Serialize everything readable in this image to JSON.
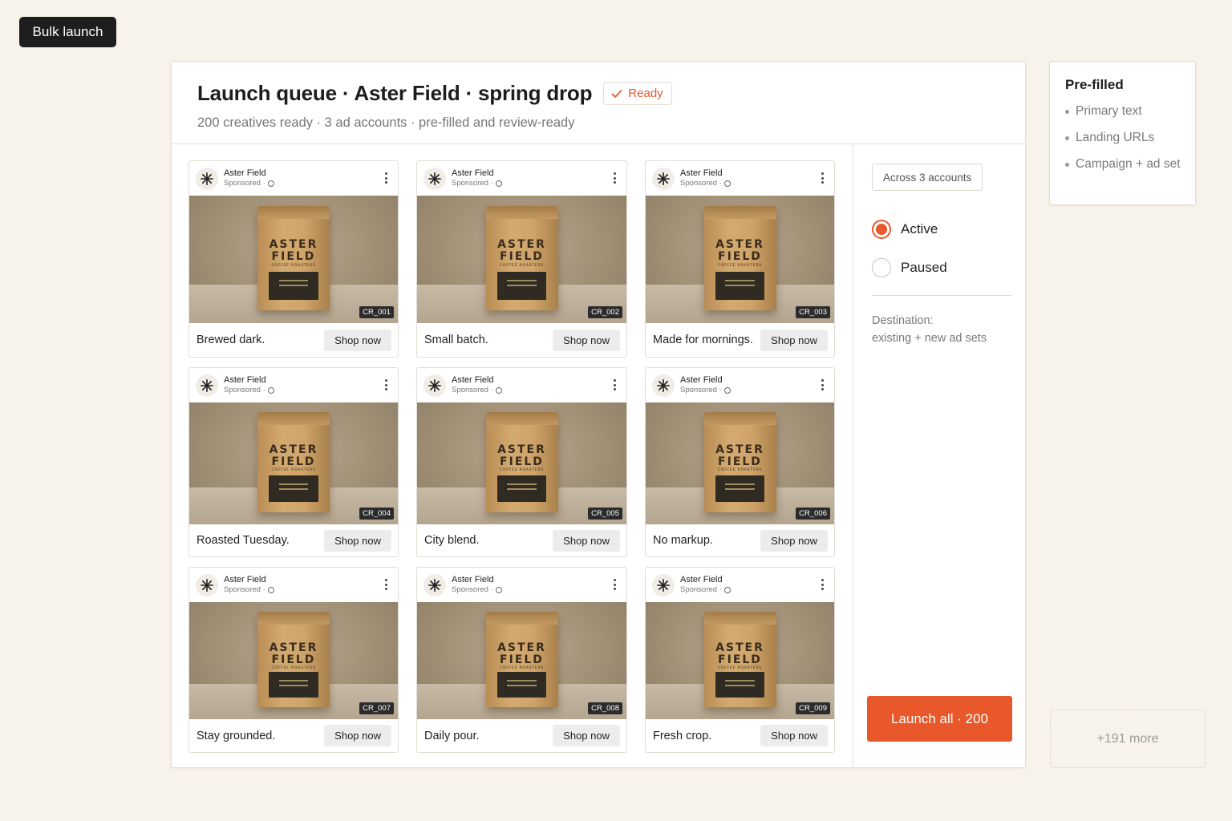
{
  "top_button": {
    "label": "Bulk launch"
  },
  "queue": {
    "title": "Launch queue · Aster Field · spring drop",
    "status": "Ready",
    "subtitle": "200 creatives ready · 3 ad accounts · pre-filled and review-ready"
  },
  "brand": {
    "name": "Aster Field",
    "sponsored": "Sponsored ·"
  },
  "bag": {
    "line1": "ASTER",
    "line2": "FIELD",
    "line3": "COFFEE ROASTERS"
  },
  "cta": "Shop now",
  "creatives": [
    {
      "id": "CR_001",
      "headline": "Brewed dark."
    },
    {
      "id": "CR_002",
      "headline": "Small batch."
    },
    {
      "id": "CR_003",
      "headline": "Made for mornings."
    },
    {
      "id": "CR_004",
      "headline": "Roasted Tuesday."
    },
    {
      "id": "CR_005",
      "headline": "City blend."
    },
    {
      "id": "CR_006",
      "headline": "No markup."
    },
    {
      "id": "CR_007",
      "headline": "Stay grounded."
    },
    {
      "id": "CR_008",
      "headline": "Daily pour."
    },
    {
      "id": "CR_009",
      "headline": "Fresh crop."
    }
  ],
  "settings": {
    "accounts_chip": "Across 3 accounts",
    "status_options": [
      {
        "label": "Active",
        "selected": true
      },
      {
        "label": "Paused",
        "selected": false
      }
    ],
    "destination_label": "Destination:",
    "destination_value": "existing + new ad sets",
    "launch_label": "Launch all · 200"
  },
  "prefilled": {
    "title": "Pre-filled",
    "items": [
      "Primary text",
      "Landing URLs",
      "Campaign + ad set"
    ]
  },
  "more": {
    "label": "+191 more"
  },
  "colors": {
    "accent": "#e8582a",
    "background": "#f8f3ea",
    "dark_button": "#1e1e1e"
  }
}
